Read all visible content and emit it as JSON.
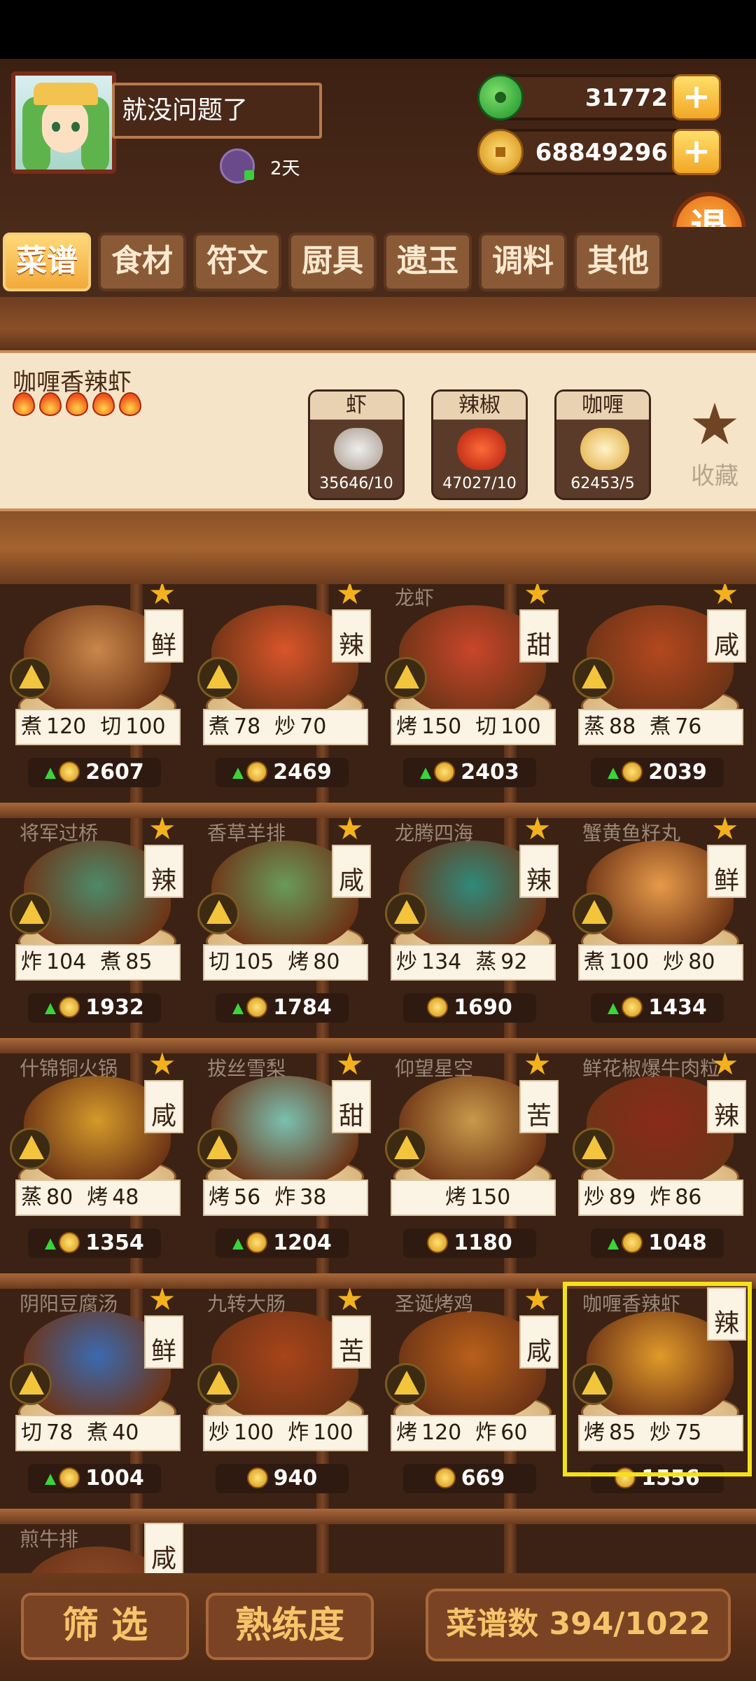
{
  "player": {
    "name": "就没问题了",
    "days": "2天"
  },
  "currency": {
    "jade": "31772",
    "coins": "68849296",
    "plus": "+"
  },
  "exit_label": "退",
  "tabs": [
    {
      "label": "菜谱",
      "active": true
    },
    {
      "label": "食材"
    },
    {
      "label": "符文"
    },
    {
      "label": "厨具"
    },
    {
      "label": "遗玉"
    },
    {
      "label": "调料"
    },
    {
      "label": "其他"
    }
  ],
  "detail": {
    "name": "咖喱香辣虾",
    "flames": 5,
    "ingredients": [
      {
        "label": "虾",
        "count": "35646/10",
        "color": "#c9b8a8"
      },
      {
        "label": "辣椒",
        "count": "47027/10",
        "color": "#d63a1a"
      },
      {
        "label": "咖喱",
        "count": "62453/5",
        "color": "#e8b843"
      }
    ],
    "favorite_label": "收藏",
    "favorite_icon": "star-icon"
  },
  "recipes": [
    {
      "name": "",
      "flavor": "鲜",
      "starred": true,
      "skills": [
        [
          "煮",
          "120"
        ],
        [
          "切",
          "100"
        ]
      ],
      "price": "2607",
      "up": true
    },
    {
      "name": "",
      "flavor": "辣",
      "starred": true,
      "skills": [
        [
          "煮",
          "78"
        ],
        [
          "炒",
          "70"
        ]
      ],
      "price": "2469",
      "up": true
    },
    {
      "name": "龙虾",
      "flavor": "甜",
      "starred": true,
      "skills": [
        [
          "烤",
          "150"
        ],
        [
          "切",
          "100"
        ]
      ],
      "price": "2403",
      "up": true
    },
    {
      "name": "",
      "flavor": "咸",
      "starred": true,
      "skills": [
        [
          "蒸",
          "88"
        ],
        [
          "煮",
          "76"
        ]
      ],
      "price": "2039",
      "up": true
    },
    {
      "name": "将军过桥",
      "flavor": "辣",
      "starred": true,
      "skills": [
        [
          "炸",
          "104"
        ],
        [
          "煮",
          "85"
        ]
      ],
      "price": "1932",
      "up": true
    },
    {
      "name": "香草羊排",
      "flavor": "咸",
      "starred": true,
      "skills": [
        [
          "切",
          "105"
        ],
        [
          "烤",
          "80"
        ]
      ],
      "price": "1784",
      "up": true
    },
    {
      "name": "龙腾四海",
      "flavor": "辣",
      "starred": true,
      "skills": [
        [
          "炒",
          "134"
        ],
        [
          "蒸",
          "92"
        ]
      ],
      "price": "1690",
      "up": false
    },
    {
      "name": "蟹黄鱼籽丸",
      "flavor": "鲜",
      "starred": true,
      "skills": [
        [
          "煮",
          "100"
        ],
        [
          "炒",
          "80"
        ]
      ],
      "price": "1434",
      "up": true
    },
    {
      "name": "什锦铜火锅",
      "flavor": "咸",
      "starred": true,
      "skills": [
        [
          "蒸",
          "80"
        ],
        [
          "烤",
          "48"
        ]
      ],
      "price": "1354",
      "up": true
    },
    {
      "name": "拔丝雪梨",
      "flavor": "甜",
      "starred": true,
      "skills": [
        [
          "烤",
          "56"
        ],
        [
          "炸",
          "38"
        ]
      ],
      "price": "1204",
      "up": true
    },
    {
      "name": "仰望星空",
      "flavor": "苦",
      "starred": true,
      "skills": [
        [
          "烤",
          "150"
        ]
      ],
      "price": "1180",
      "up": false
    },
    {
      "name": "鲜花椒爆牛肉粒",
      "flavor": "辣",
      "starred": true,
      "skills": [
        [
          "炒",
          "89"
        ],
        [
          "炸",
          "86"
        ]
      ],
      "price": "1048",
      "up": true
    },
    {
      "name": "阴阳豆腐汤",
      "flavor": "鲜",
      "starred": true,
      "skills": [
        [
          "切",
          "78"
        ],
        [
          "煮",
          "40"
        ]
      ],
      "price": "1004",
      "up": true
    },
    {
      "name": "九转大肠",
      "flavor": "苦",
      "starred": true,
      "skills": [
        [
          "炒",
          "100"
        ],
        [
          "炸",
          "100"
        ]
      ],
      "price": "940",
      "up": false
    },
    {
      "name": "圣诞烤鸡",
      "flavor": "咸",
      "starred": true,
      "skills": [
        [
          "烤",
          "120"
        ],
        [
          "炸",
          "60"
        ]
      ],
      "price": "669",
      "up": false
    },
    {
      "name": "咖喱香辣虾",
      "flavor": "辣",
      "starred": false,
      "selected": true,
      "skills": [
        [
          "烤",
          "85"
        ],
        [
          "炒",
          "75"
        ]
      ],
      "price": "1556",
      "up": false
    },
    {
      "name": "煎牛排",
      "flavor": "咸",
      "starred": false,
      "skills": [],
      "price": "",
      "up": false
    }
  ],
  "bottom": {
    "filter": "筛 选",
    "proficiency": "熟练度",
    "recipe_count": "菜谱数 394/1022"
  }
}
